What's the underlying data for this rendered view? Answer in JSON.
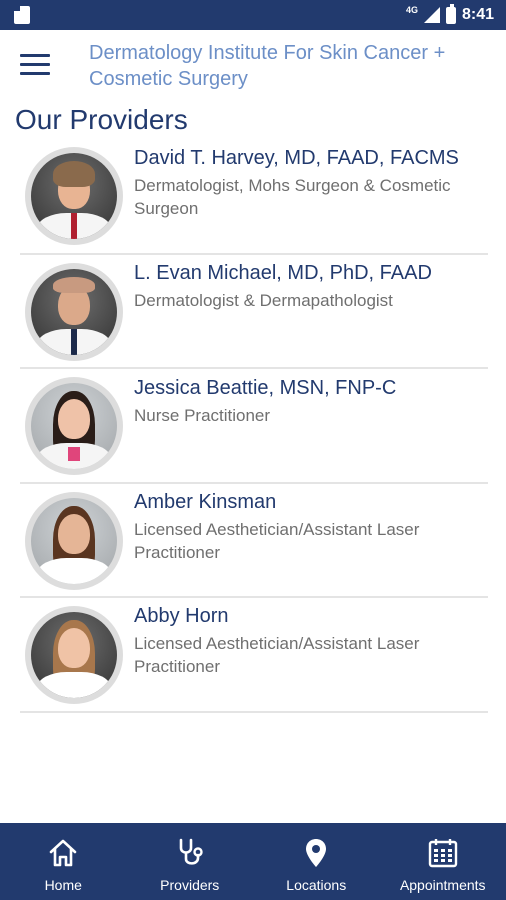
{
  "status_bar": {
    "time": "8:41",
    "network": "4G"
  },
  "header": {
    "title": "Dermatology Institute For Skin Cancer + Cosmetic Surgery"
  },
  "page": {
    "title": "Our Providers"
  },
  "providers": [
    {
      "name": "David T. Harvey, MD, FAAD, FACMS",
      "role": "Dermatologist, Mohs Surgeon & Cosmetic Surgeon"
    },
    {
      "name": "L. Evan Michael, MD, PhD, FAAD",
      "role": "Dermatologist & Dermapathologist"
    },
    {
      "name": "Jessica Beattie, MSN, FNP-C",
      "role": "Nurse Practitioner"
    },
    {
      "name": "Amber Kinsman",
      "role": "Licensed Aesthetician/Assistant Laser Practitioner"
    },
    {
      "name": "Abby Horn",
      "role": "Licensed Aesthetician/Assistant Laser Practitioner"
    }
  ],
  "bottom_nav": [
    {
      "label": "Home",
      "icon": "home-icon"
    },
    {
      "label": "Providers",
      "icon": "stethoscope-icon"
    },
    {
      "label": "Locations",
      "icon": "map-pin-icon"
    },
    {
      "label": "Appointments",
      "icon": "calendar-icon"
    }
  ],
  "colors": {
    "brand_navy": "#223a6e",
    "header_title": "#6c8fc7",
    "divider": "#e4e4e4"
  }
}
